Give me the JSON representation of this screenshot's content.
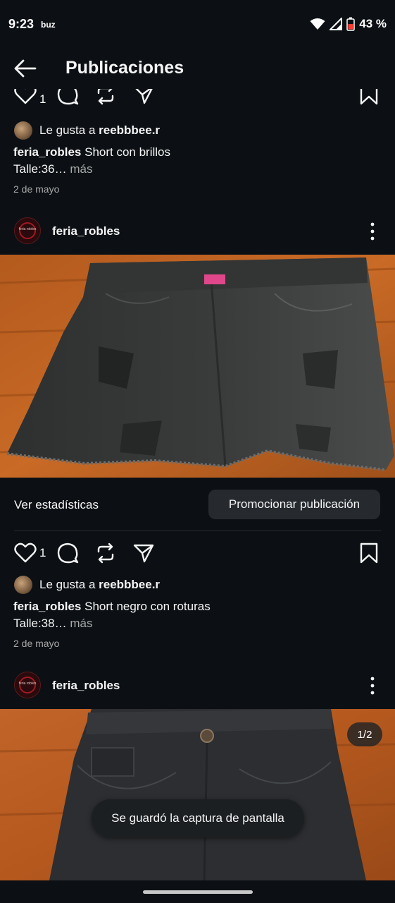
{
  "status_bar": {
    "time": "9:23",
    "app_badge": "buz",
    "battery": "43 %"
  },
  "header": {
    "title": "Publicaciones"
  },
  "post_prev": {
    "like_count": "1",
    "liked_by_prefix": "Le gusta a ",
    "liked_by_user": "reebbbee.r",
    "caption_user": "feria_robles",
    "caption_text": " Short con brillos",
    "caption_line2": "Talle:36…",
    "more": " más",
    "date": "2 de mayo"
  },
  "post_main": {
    "username": "feria_robles",
    "avatar_text": "feria robles",
    "insights_label": "Ver estadísticas",
    "promote_label": "Promocionar publicación",
    "like_count": "1",
    "liked_by_prefix": "Le gusta a ",
    "liked_by_user": "reebbbee.r",
    "caption_user": "feria_robles",
    "caption_text": " Short negro con roturas",
    "caption_line2": "Talle:38…",
    "more": " más",
    "date": "2 de mayo"
  },
  "post_next": {
    "username": "feria_robles",
    "avatar_text": "feria robles",
    "carousel_counter": "1/2"
  },
  "toast": {
    "message": "Se guardó la captura de pantalla"
  },
  "colors": {
    "background": "#0c1014",
    "text": "#f5f5f5",
    "secondary": "#a8a8a8",
    "button": "#262a2f",
    "brand_red": "#9e1b24"
  },
  "icons": [
    "back-arrow-icon",
    "heart-icon",
    "comment-icon",
    "repost-icon",
    "share-icon",
    "bookmark-icon",
    "more-vertical-icon",
    "wifi-icon",
    "signal-icon",
    "battery-icon"
  ]
}
